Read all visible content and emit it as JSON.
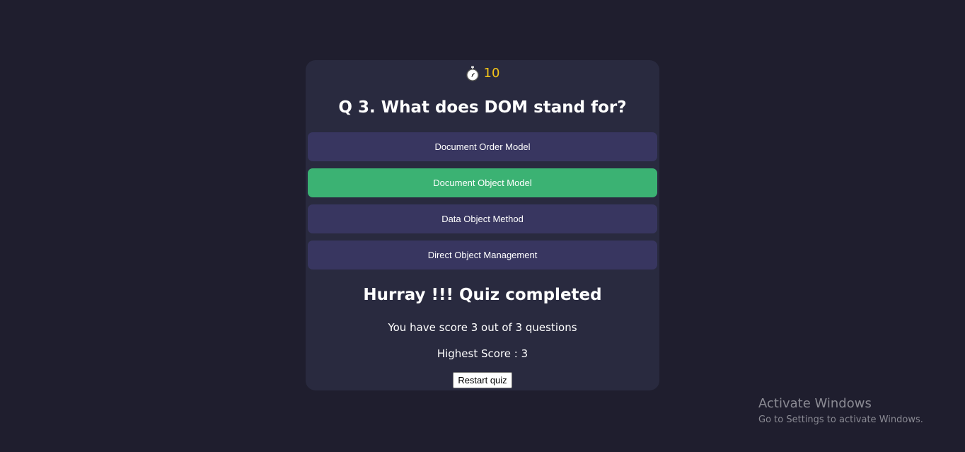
{
  "timer": {
    "icon": "stopwatch-icon",
    "value": "10",
    "color": "#f5c518"
  },
  "question": {
    "text": "Q 3. What does DOM stand for?"
  },
  "options": [
    {
      "label": "Document Order Model",
      "state": "default"
    },
    {
      "label": "Document Object Model",
      "state": "correct"
    },
    {
      "label": "Data Object Method",
      "state": "default"
    },
    {
      "label": "Direct Object Management",
      "state": "default"
    }
  ],
  "result": {
    "title": "Hurray !!! Quiz completed",
    "score_text": "You have score 3 out of 3 questions",
    "highest_score_text": "Highest Score : 3",
    "restart_label": "Restart quiz"
  },
  "watermark": {
    "title": "Activate Windows",
    "subtitle": "Go to Settings to activate Windows."
  },
  "colors": {
    "background": "#1f1e2e",
    "card": "#292a3f",
    "option_default": "#383660",
    "option_correct": "#3bb273"
  }
}
